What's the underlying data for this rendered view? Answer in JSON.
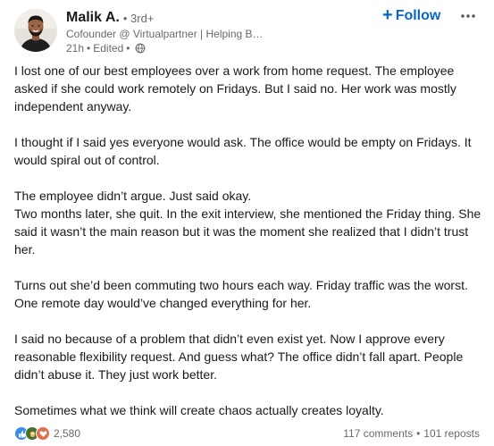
{
  "author": {
    "name": "Malik A.",
    "degree": "• 3rd+",
    "headline": "Cofounder @ Virtualpartner | Helping Businesses Fix Their Pipeli…",
    "time": "21h",
    "edited": "Edited",
    "meta_sep": "•",
    "visibility_icon": "globe-icon"
  },
  "actions": {
    "follow_plus": "+",
    "follow_label": "Follow",
    "more_icon": "more-horizontal-icon"
  },
  "post": {
    "paragraphs": [
      "I lost one of our best employees over a work from home request. The employee asked if she could work remotely on Fridays. But I said no. Her work was mostly independent anyway.",
      "I thought if I said yes everyone would ask. The office would be empty on Fridays. It would spiral out of control.",
      "The employee didn’t argue. Just said okay.",
      "Two months later, she quit. In the exit interview, she mentioned the Friday thing. She said it wasn’t the main reason but it was the moment she realized that I didn’t trust her.",
      "Turns out she’d been commuting two hours each way. Friday traffic was the worst. One remote day would’ve changed everything for her.",
      "I said no because of a problem that didn’t even exist yet. Now I approve every reasonable flexibility request. And guess what? The office didn’t fall apart. People didn’t abuse it. They just work better.",
      "Sometimes what we think will create chaos actually creates loyalty."
    ]
  },
  "social": {
    "reaction_icons": [
      "like-icon",
      "celebrate-icon",
      "love-icon"
    ],
    "reaction_count": "2,580",
    "comments": "117 comments",
    "dot": "•",
    "reposts": "101 reposts"
  },
  "colors": {
    "accent": "#0a66c2",
    "like": "#378fe9",
    "celebrate": "#44712e",
    "love": "#df704d",
    "text_primary": "#191919",
    "text_secondary": "#666666"
  }
}
